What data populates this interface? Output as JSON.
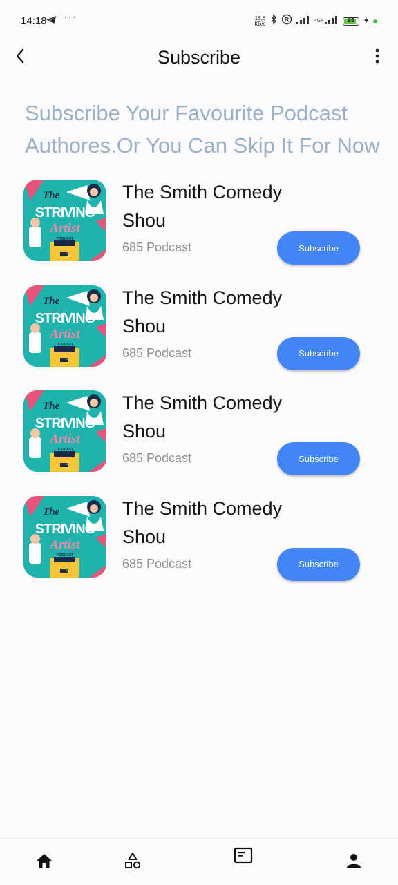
{
  "status_bar": {
    "time": "14:18",
    "net_speed_value": "16,6",
    "net_speed_unit": "КБ/с",
    "network": "4G+",
    "battery": "85",
    "icons": [
      "telegram-icon",
      "more-dots-icon",
      "bluetooth-icon",
      "registered-icon",
      "signal-icon",
      "signal-icon",
      "battery-icon",
      "charging-icon"
    ]
  },
  "header": {
    "title": "Subscribe",
    "back_icon": "back-arrow-icon",
    "menu_icon": "more-vertical-icon"
  },
  "headline": {
    "line1": "Subscribe Your Favourite Podcast",
    "line2": "Authores.Or You Can Skip It For Now"
  },
  "podcasts": [
    {
      "title_line1": "The Smith Comedy",
      "title_line2": "Shou",
      "count": "685 Podcast",
      "button": "Subscribe",
      "cover": {
        "the": "The",
        "striving": "STRIVING",
        "artist": "Artist",
        "podcast": "PODCAST",
        "episode": "23"
      }
    },
    {
      "title_line1": "The Smith Comedy",
      "title_line2": "Shou",
      "count": "685 Podcast",
      "button": "Subscribe",
      "cover": {
        "the": "The",
        "striving": "STRIVING",
        "artist": "Artist",
        "podcast": "PODCAST",
        "episode": "24"
      }
    },
    {
      "title_line1": "The Smith Comedy",
      "title_line2": "Shou",
      "count": "685 Podcast",
      "button": "Subscribe",
      "cover": {
        "the": "The",
        "striving": "STRIVING",
        "artist": "Artist",
        "podcast": "PODCAST",
        "episode": "23"
      }
    },
    {
      "title_line1": "The Smith Comedy",
      "title_line2": "Shou",
      "count": "685 Podcast",
      "button": "Subscribe",
      "cover": {
        "the": "The",
        "striving": "STRIVING",
        "artist": "Artist",
        "podcast": "PODCAST",
        "episode": "24"
      }
    }
  ],
  "bottom_nav": {
    "items": [
      "home-icon",
      "shapes-icon",
      "article-icon",
      "person-icon"
    ]
  },
  "colors": {
    "accent": "#4286f5",
    "headline": "#9ab1c8",
    "background": "#fcfafd",
    "cover_teal": "#1fb3ae",
    "muted_text": "#8e8e8e"
  }
}
